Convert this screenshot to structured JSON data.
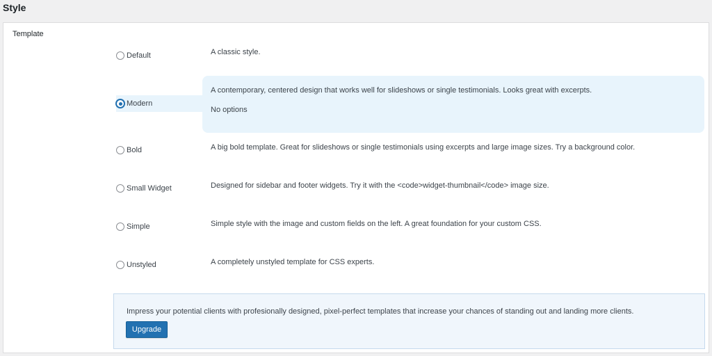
{
  "section": {
    "title": "Style"
  },
  "template_row": {
    "label": "Template",
    "selected": "Modern",
    "options": [
      {
        "label": "Default",
        "description": "A classic style."
      },
      {
        "label": "Modern",
        "description": "A contemporary, centered design that works well for slideshows or single testimonials. Looks great with excerpts.",
        "extra": "No options"
      },
      {
        "label": "Bold",
        "description": "A big bold template. Great for slideshows or single testimonials using excerpts and large image sizes. Try a background color."
      },
      {
        "label": "Small Widget",
        "description": "Designed for sidebar and footer widgets. Try it with the <code>widget-thumbnail</code> image size."
      },
      {
        "label": "Simple",
        "description": "Simple style with the image and custom fields on the left. A great foundation for your custom CSS."
      },
      {
        "label": "Unstyled",
        "description": "A completely unstyled template for CSS experts."
      }
    ]
  },
  "promo": {
    "text": "Impress your potential clients with profesionally designed, pixel-perfect templates that increase your chances of standing out and landing more clients.",
    "button_label": "Upgrade"
  },
  "colors": {
    "accent": "#2271b1",
    "selected_bg": "#e8f4fc",
    "promo_bg": "#f0f6fc"
  }
}
